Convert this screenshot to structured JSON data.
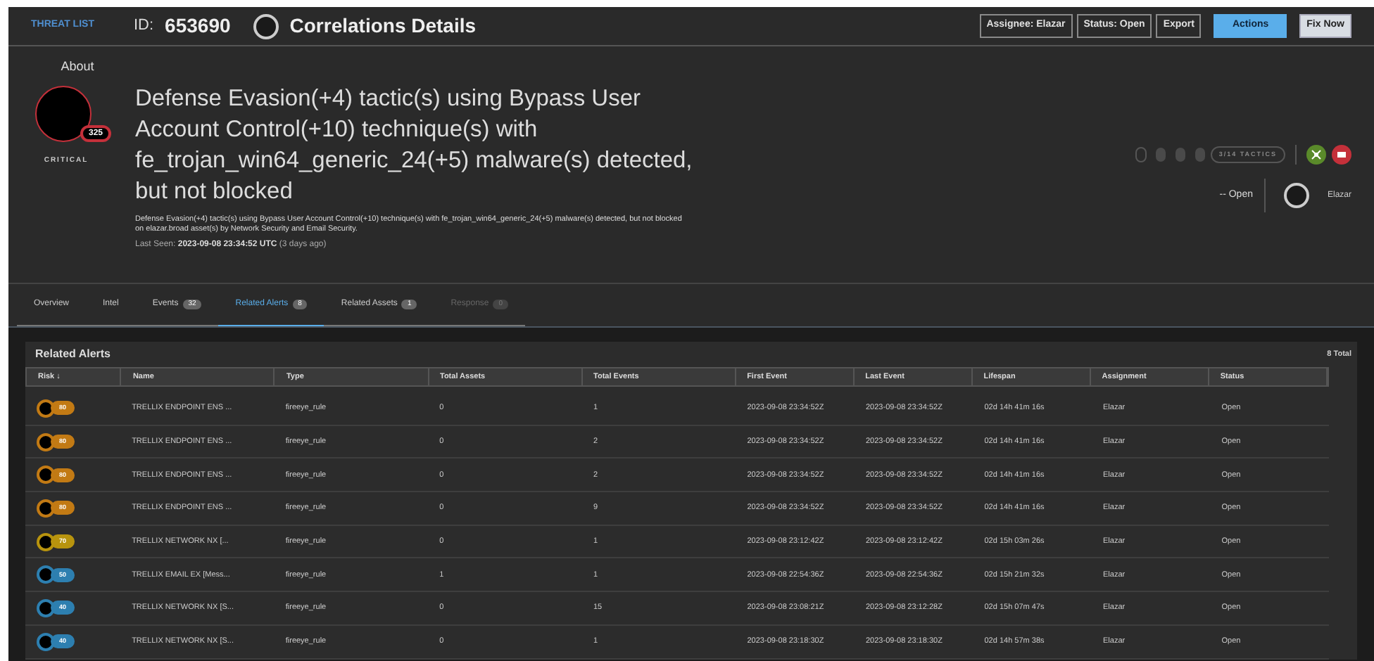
{
  "topbar": {
    "breadcrumb": "THREAT LIST",
    "id_label": "ID:",
    "id_value": "653690",
    "title": "Correlations Details",
    "buttons": [
      {
        "label": "Assignee: Elazar",
        "kind": "outline"
      },
      {
        "label": "Status: Open",
        "kind": "outline"
      },
      {
        "label": "Export",
        "kind": "outline"
      },
      {
        "label": "Actions",
        "kind": "primary"
      },
      {
        "label": "Fix Now",
        "kind": "light"
      }
    ]
  },
  "about": {
    "label": "About",
    "score": "325",
    "severity": "CRITICAL",
    "headline": "Defense Evasion(+4) tactic(s) using Bypass User Account Control(+10) technique(s) with fe_trojan_win64_generic_24(+5) malware(s) detected, but not blocked",
    "description": "Defense Evasion(+4) tactic(s) using Bypass User Account Control(+10) technique(s) with fe_trojan_win64_generic_24(+5) malware(s) detected, but not blocked on elazar.broad asset(s) by Network Security and Email Security.",
    "last_seen_label": "Last Seen:",
    "last_seen": "2023-09-08 23:34:52 UTC",
    "last_seen_ago": "(3 days ago)",
    "tactics": "3/14 TACTICS",
    "status": "-- Open",
    "assignee": "Elazar"
  },
  "tabs": [
    {
      "label": "Overview",
      "selected": false,
      "disabled": false
    },
    {
      "label": "Intel",
      "selected": false,
      "disabled": false
    },
    {
      "label": "Events",
      "count": "32",
      "selected": false,
      "disabled": false
    },
    {
      "label": "Related Alerts",
      "count": "8",
      "selected": true,
      "disabled": false
    },
    {
      "label": "Related Assets",
      "count": "1",
      "selected": false,
      "disabled": false
    },
    {
      "label": "Response",
      "count": "0",
      "selected": false,
      "disabled": true
    }
  ],
  "table": {
    "title": "Related Alerts",
    "total": "8 Total",
    "columns": [
      "Risk ↓",
      "Name",
      "Type",
      "Total Assets",
      "Total Events",
      "First Event",
      "Last Event",
      "Lifespan",
      "Assignment",
      "Status"
    ],
    "rows": [
      {
        "color": "#c27a14",
        "cells": [
          "80",
          "TRELLIX ENDPOINT ENS ...",
          "fireeye_rule",
          "0",
          "1",
          "2023-09-08 23:34:52Z",
          "2023-09-08 23:34:52Z",
          "02d 14h 41m 16s",
          "Elazar",
          "Open"
        ]
      },
      {
        "color": "#c27a14",
        "cells": [
          "80",
          "TRELLIX ENDPOINT ENS ...",
          "fireeye_rule",
          "0",
          "2",
          "2023-09-08 23:34:52Z",
          "2023-09-08 23:34:52Z",
          "02d 14h 41m 16s",
          "Elazar",
          "Open"
        ]
      },
      {
        "color": "#c27a14",
        "cells": [
          "80",
          "TRELLIX ENDPOINT ENS ...",
          "fireeye_rule",
          "0",
          "2",
          "2023-09-08 23:34:52Z",
          "2023-09-08 23:34:52Z",
          "02d 14h 41m 16s",
          "Elazar",
          "Open"
        ]
      },
      {
        "color": "#c27a14",
        "cells": [
          "80",
          "TRELLIX ENDPOINT ENS ...",
          "fireeye_rule",
          "0",
          "9",
          "2023-09-08 23:34:52Z",
          "2023-09-08 23:34:52Z",
          "02d 14h 41m 16s",
          "Elazar",
          "Open"
        ]
      },
      {
        "color": "#b8940e",
        "cells": [
          "70",
          "TRELLIX NETWORK NX [...",
          "fireeye_rule",
          "0",
          "1",
          "2023-09-08 23:12:42Z",
          "2023-09-08 23:12:42Z",
          "02d 15h 03m 26s",
          "Elazar",
          "Open"
        ]
      },
      {
        "color": "#2d7fb0",
        "cells": [
          "50",
          "TRELLIX EMAIL EX [Mess...",
          "fireeye_rule",
          "1",
          "1",
          "2023-09-08 22:54:36Z",
          "2023-09-08 22:54:36Z",
          "02d 15h 21m 32s",
          "Elazar",
          "Open"
        ]
      },
      {
        "color": "#2d7fb0",
        "cells": [
          "40",
          "TRELLIX NETWORK NX [S...",
          "fireeye_rule",
          "0",
          "15",
          "2023-09-08 23:08:21Z",
          "2023-09-08 23:12:28Z",
          "02d 15h 07m 47s",
          "Elazar",
          "Open"
        ]
      },
      {
        "color": "#2d7fb0",
        "cells": [
          "40",
          "TRELLIX NETWORK NX [S...",
          "fireeye_rule",
          "0",
          "1",
          "2023-09-08 23:18:30Z",
          "2023-09-08 23:18:30Z",
          "02d 14h 57m 38s",
          "Elazar",
          "Open"
        ]
      }
    ]
  }
}
